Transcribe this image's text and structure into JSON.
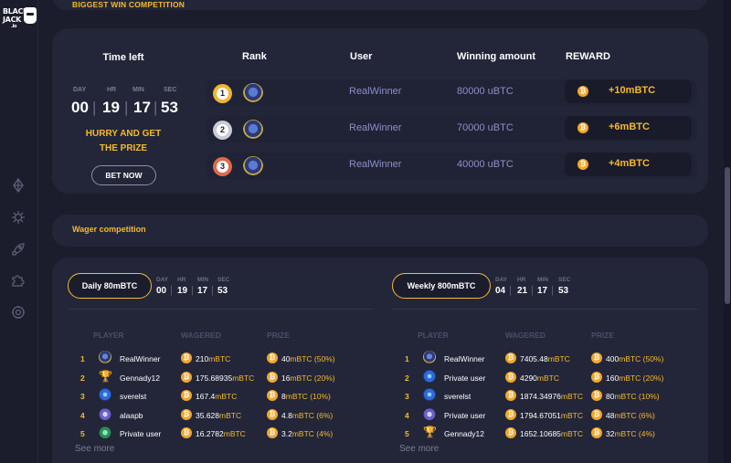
{
  "sidebar": {
    "logo_lines": [
      "BLACK",
      "JACK",
      ".io"
    ],
    "icons": [
      "diamond-icon",
      "virus-icon",
      "rocket-icon",
      "puzzle-icon",
      "gear-icon"
    ]
  },
  "top_banner": {
    "title": "Biggest win competition"
  },
  "win_competition": {
    "time_left_label": "Time left",
    "countdown": {
      "labels": [
        "DAY",
        "HR",
        "MIN",
        "SEC"
      ],
      "values": [
        "00",
        "19",
        "17",
        "53"
      ]
    },
    "hurry_text": [
      "HURRY AND GET",
      "THE PRIZE"
    ],
    "bet_now": "BET NOW",
    "columns": {
      "rank": "Rank",
      "user": "User",
      "amount": "Winning amount",
      "reward": "REWARD"
    },
    "rows": [
      {
        "rank": "1",
        "user": "RealWinner",
        "amount": "80000 uBTC",
        "reward": "+10mBTC"
      },
      {
        "rank": "2",
        "user": "RealWinner",
        "amount": "70000 uBTC",
        "reward": "+6mBTC"
      },
      {
        "rank": "3",
        "user": "RealWinner",
        "amount": "40000 uBTC",
        "reward": "+4mBTC"
      }
    ]
  },
  "wager_banner": {
    "title": "Wager competition"
  },
  "daily": {
    "button": "Daily 80mBTC",
    "labels": [
      "DAY",
      "HR",
      "MIN",
      "SEC"
    ],
    "values": [
      "00",
      "19",
      "17",
      "53"
    ],
    "headers": {
      "player": "PLAYER",
      "wagered": "WAGERED",
      "prize": "PRIZE"
    },
    "rows": [
      {
        "n": "1",
        "avatar": "lion",
        "name": "RealWinner",
        "wagered": "210",
        "prize": "40",
        "pct": " (50%)"
      },
      {
        "n": "2",
        "avatar": "trophy",
        "name": "Gennady12",
        "wagered": "175.68935",
        "prize": "16",
        "pct": " (20%)"
      },
      {
        "n": "3",
        "avatar": "blue",
        "name": "sverelst",
        "wagered": "167.4",
        "prize": "8",
        "pct": " (10%)"
      },
      {
        "n": "4",
        "avatar": "cat",
        "name": "alaapb",
        "wagered": "35.628",
        "prize": "4.8",
        "pct": " (6%)"
      },
      {
        "n": "5",
        "avatar": "alien",
        "name": "Private user",
        "wagered": "16.2782",
        "prize": "3.2",
        "pct": " (4%)"
      }
    ],
    "see_more": "See more"
  },
  "weekly": {
    "button": "Weekly 800mBTC",
    "labels": [
      "DAY",
      "HR",
      "MIN",
      "SEC"
    ],
    "values": [
      "04",
      "21",
      "17",
      "53"
    ],
    "headers": {
      "player": "PLAYER",
      "wagered": "WAGERED",
      "prize": "PRIZE"
    },
    "rows": [
      {
        "n": "1",
        "avatar": "lion",
        "name": "RealWinner",
        "wagered": "7405.48",
        "prize": "400",
        "pct": " (50%)"
      },
      {
        "n": "2",
        "avatar": "blue",
        "name": "Private user",
        "wagered": "4290",
        "prize": "160",
        "pct": " (20%)"
      },
      {
        "n": "3",
        "avatar": "blue",
        "name": "sverelst",
        "wagered": "1874.34976",
        "prize": "80",
        "pct": " (10%)"
      },
      {
        "n": "4",
        "avatar": "cat",
        "name": "Private user",
        "wagered": "1794.67051",
        "prize": "48",
        "pct": " (6%)"
      },
      {
        "n": "5",
        "avatar": "trophy",
        "name": "Gennady12",
        "wagered": "1652.10685",
        "prize": "32",
        "pct": " (4%)"
      }
    ],
    "see_more": "See more"
  },
  "unit": "mBTC",
  "coin_symbol": "₿",
  "colors": {
    "accent": "#f5b92c",
    "background": "#1b1d2d",
    "card": "#232639",
    "coin": "#f4a72b"
  }
}
